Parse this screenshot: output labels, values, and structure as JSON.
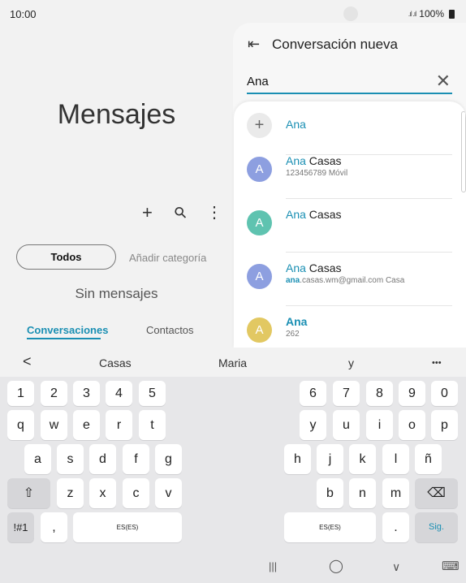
{
  "status": {
    "time": "10:00",
    "signal": ".ıl .ıl",
    "battery": "100%"
  },
  "left": {
    "title": "Mensajes",
    "add_glyph": "+",
    "search_glyph": "⚲",
    "more_glyph": "⋮",
    "filter_all": "Todos",
    "add_category": "Añadir categoría",
    "empty": "Sin mensajes",
    "tab_conversations": "Conversaciones",
    "tab_contacts": "Contactos"
  },
  "panel": {
    "back_glyph": "⇤",
    "title": "Conversación nueva",
    "search_value": "Ana",
    "clear_glyph": "✕"
  },
  "contacts": [
    {
      "avatar": "+",
      "hl": "Ana",
      "rest": "",
      "sub_hl": "",
      "sub": ""
    },
    {
      "avatar": "A",
      "hl": "Ana",
      "rest": " Casas",
      "sub_hl": "",
      "sub": "123456789  Móvil"
    },
    {
      "avatar": "A",
      "hl": "Ana",
      "rest": " Casas",
      "sub_hl": "",
      "sub": ""
    },
    {
      "avatar": "A",
      "hl": "Ana",
      "rest": " Casas",
      "sub_hl": "ana",
      "sub": ".casas.wm@gmail.com  Casa"
    },
    {
      "avatar": "A",
      "hl": "Ana",
      "rest": "",
      "sub_hl": "",
      "sub": "262"
    }
  ],
  "colors": {
    "accent": "#1a8fb3",
    "avatar_blue": "#8d9fe0",
    "avatar_teal": "#5fc3b0",
    "avatar_yellow": "#e2c862"
  },
  "keyboard": {
    "suggestions": {
      "back": "<",
      "s1": "Casas",
      "s2": "Maria",
      "s3": "y",
      "more": "•••"
    },
    "row_numbers_left": [
      "1",
      "2",
      "3",
      "4",
      "5"
    ],
    "row_numbers_right": [
      "6",
      "7",
      "8",
      "9",
      "0"
    ],
    "row1_left": [
      "q",
      "w",
      "e",
      "r",
      "t"
    ],
    "row1_right": [
      "y",
      "u",
      "i",
      "o",
      "p"
    ],
    "row2_left": [
      "a",
      "s",
      "d",
      "f",
      "g"
    ],
    "row2_right": [
      "h",
      "j",
      "k",
      "l",
      "ñ"
    ],
    "row3_left": [
      "z",
      "x",
      "c",
      "v"
    ],
    "row3_right": [
      "b",
      "n",
      "m"
    ],
    "shift": "⇧",
    "backspace": "⌫",
    "symbols": "!#1",
    "comma": ",",
    "space_left": "ES(ES)",
    "space_right": "ES(ES)",
    "period": ".",
    "next": "Sig."
  },
  "nav": {
    "recent": "|||",
    "home": "◯",
    "back": "∨",
    "keyboard": "⌨"
  }
}
